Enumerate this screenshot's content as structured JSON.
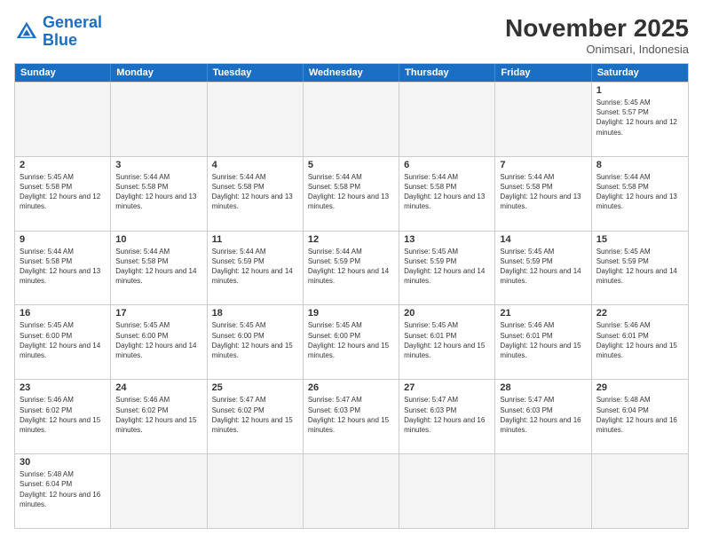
{
  "logo": {
    "text_general": "General",
    "text_blue": "Blue"
  },
  "header": {
    "month": "November 2025",
    "location": "Onimsari, Indonesia"
  },
  "days_of_week": [
    "Sunday",
    "Monday",
    "Tuesday",
    "Wednesday",
    "Thursday",
    "Friday",
    "Saturday"
  ],
  "weeks": [
    [
      {
        "day": "",
        "info": "",
        "empty": true
      },
      {
        "day": "",
        "info": "",
        "empty": true
      },
      {
        "day": "",
        "info": "",
        "empty": true
      },
      {
        "day": "",
        "info": "",
        "empty": true
      },
      {
        "day": "",
        "info": "",
        "empty": true
      },
      {
        "day": "",
        "info": "",
        "empty": true
      },
      {
        "day": "1",
        "info": "Sunrise: 5:45 AM\nSunset: 5:57 PM\nDaylight: 12 hours and 12 minutes."
      }
    ],
    [
      {
        "day": "2",
        "info": "Sunrise: 5:45 AM\nSunset: 5:58 PM\nDaylight: 12 hours and 12 minutes."
      },
      {
        "day": "3",
        "info": "Sunrise: 5:44 AM\nSunset: 5:58 PM\nDaylight: 12 hours and 13 minutes."
      },
      {
        "day": "4",
        "info": "Sunrise: 5:44 AM\nSunset: 5:58 PM\nDaylight: 12 hours and 13 minutes."
      },
      {
        "day": "5",
        "info": "Sunrise: 5:44 AM\nSunset: 5:58 PM\nDaylight: 12 hours and 13 minutes."
      },
      {
        "day": "6",
        "info": "Sunrise: 5:44 AM\nSunset: 5:58 PM\nDaylight: 12 hours and 13 minutes."
      },
      {
        "day": "7",
        "info": "Sunrise: 5:44 AM\nSunset: 5:58 PM\nDaylight: 12 hours and 13 minutes."
      },
      {
        "day": "8",
        "info": "Sunrise: 5:44 AM\nSunset: 5:58 PM\nDaylight: 12 hours and 13 minutes."
      }
    ],
    [
      {
        "day": "9",
        "info": "Sunrise: 5:44 AM\nSunset: 5:58 PM\nDaylight: 12 hours and 13 minutes."
      },
      {
        "day": "10",
        "info": "Sunrise: 5:44 AM\nSunset: 5:58 PM\nDaylight: 12 hours and 14 minutes."
      },
      {
        "day": "11",
        "info": "Sunrise: 5:44 AM\nSunset: 5:59 PM\nDaylight: 12 hours and 14 minutes."
      },
      {
        "day": "12",
        "info": "Sunrise: 5:44 AM\nSunset: 5:59 PM\nDaylight: 12 hours and 14 minutes."
      },
      {
        "day": "13",
        "info": "Sunrise: 5:45 AM\nSunset: 5:59 PM\nDaylight: 12 hours and 14 minutes."
      },
      {
        "day": "14",
        "info": "Sunrise: 5:45 AM\nSunset: 5:59 PM\nDaylight: 12 hours and 14 minutes."
      },
      {
        "day": "15",
        "info": "Sunrise: 5:45 AM\nSunset: 5:59 PM\nDaylight: 12 hours and 14 minutes."
      }
    ],
    [
      {
        "day": "16",
        "info": "Sunrise: 5:45 AM\nSunset: 6:00 PM\nDaylight: 12 hours and 14 minutes."
      },
      {
        "day": "17",
        "info": "Sunrise: 5:45 AM\nSunset: 6:00 PM\nDaylight: 12 hours and 14 minutes."
      },
      {
        "day": "18",
        "info": "Sunrise: 5:45 AM\nSunset: 6:00 PM\nDaylight: 12 hours and 15 minutes."
      },
      {
        "day": "19",
        "info": "Sunrise: 5:45 AM\nSunset: 6:00 PM\nDaylight: 12 hours and 15 minutes."
      },
      {
        "day": "20",
        "info": "Sunrise: 5:45 AM\nSunset: 6:01 PM\nDaylight: 12 hours and 15 minutes."
      },
      {
        "day": "21",
        "info": "Sunrise: 5:46 AM\nSunset: 6:01 PM\nDaylight: 12 hours and 15 minutes."
      },
      {
        "day": "22",
        "info": "Sunrise: 5:46 AM\nSunset: 6:01 PM\nDaylight: 12 hours and 15 minutes."
      }
    ],
    [
      {
        "day": "23",
        "info": "Sunrise: 5:46 AM\nSunset: 6:02 PM\nDaylight: 12 hours and 15 minutes."
      },
      {
        "day": "24",
        "info": "Sunrise: 5:46 AM\nSunset: 6:02 PM\nDaylight: 12 hours and 15 minutes."
      },
      {
        "day": "25",
        "info": "Sunrise: 5:47 AM\nSunset: 6:02 PM\nDaylight: 12 hours and 15 minutes."
      },
      {
        "day": "26",
        "info": "Sunrise: 5:47 AM\nSunset: 6:03 PM\nDaylight: 12 hours and 15 minutes."
      },
      {
        "day": "27",
        "info": "Sunrise: 5:47 AM\nSunset: 6:03 PM\nDaylight: 12 hours and 16 minutes."
      },
      {
        "day": "28",
        "info": "Sunrise: 5:47 AM\nSunset: 6:03 PM\nDaylight: 12 hours and 16 minutes."
      },
      {
        "day": "29",
        "info": "Sunrise: 5:48 AM\nSunset: 6:04 PM\nDaylight: 12 hours and 16 minutes."
      }
    ],
    [
      {
        "day": "30",
        "info": "Sunrise: 5:48 AM\nSunset: 6:04 PM\nDaylight: 12 hours and 16 minutes."
      },
      {
        "day": "",
        "info": "",
        "empty": true
      },
      {
        "day": "",
        "info": "",
        "empty": true
      },
      {
        "day": "",
        "info": "",
        "empty": true
      },
      {
        "day": "",
        "info": "",
        "empty": true
      },
      {
        "day": "",
        "info": "",
        "empty": true
      },
      {
        "day": "",
        "info": "",
        "empty": true
      }
    ]
  ]
}
